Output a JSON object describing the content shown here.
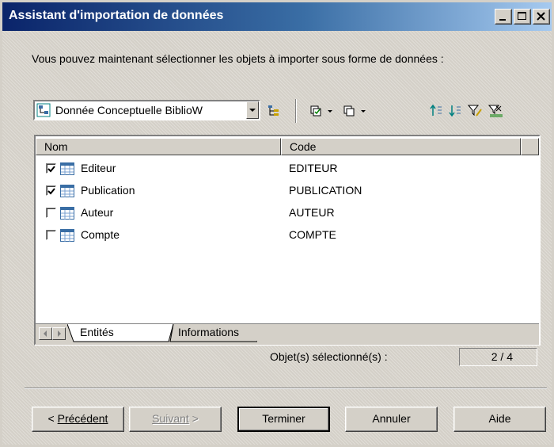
{
  "window": {
    "title": "Assistant d'importation de données"
  },
  "intro_text": "Vous pouvez maintenant sélectionner les objets à importer sous forme de données :",
  "model_select": {
    "value": "Donnée Conceptuelle BiblioW"
  },
  "toolbar": {
    "icons": [
      "tree-view-icon",
      "select-all-icon",
      "deselect-all-icon",
      "move-up-icon",
      "move-down-icon",
      "filter-icon",
      "filter-options-icon"
    ]
  },
  "list": {
    "columns": [
      "Nom",
      "Code"
    ],
    "rows": [
      {
        "name": "Editeur",
        "code": "EDITEUR",
        "checked": true
      },
      {
        "name": "Publication",
        "code": "PUBLICATION",
        "checked": true
      },
      {
        "name": "Auteur",
        "code": "AUTEUR",
        "checked": false
      },
      {
        "name": "Compte",
        "code": "COMPTE",
        "checked": false
      }
    ],
    "tabs": [
      "Entités",
      "Informations"
    ]
  },
  "selection": {
    "label": "Objet(s) sélectionné(s) :",
    "value": "2 / 4"
  },
  "buttons": {
    "previous_label": "Précédent",
    "next_label": "Suivant",
    "finish": "Terminer",
    "cancel": "Annuler",
    "help": "Aide"
  },
  "colors": {
    "titlebar_start": "#0a246a",
    "titlebar_end": "#a6caf0",
    "face": "#d4d0c8",
    "table_icon": "#3a6ea5"
  }
}
